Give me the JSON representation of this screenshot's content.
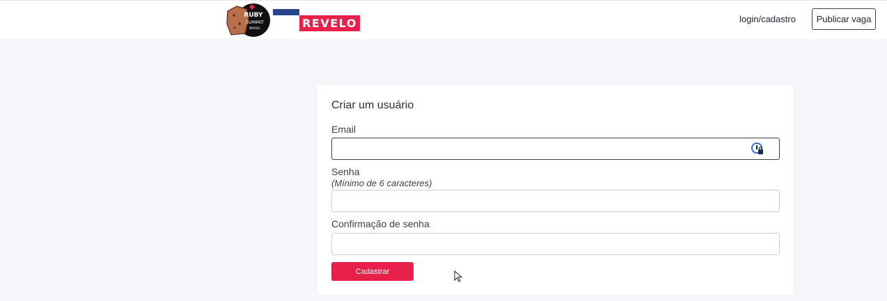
{
  "header": {
    "logo_ruby_lines": [
      "RUBY",
      "SUMMIT",
      "BRASIL"
    ],
    "logo_revelo": "REVELO",
    "login_link": "login/cadastro",
    "publish_button": "Publicar vaga"
  },
  "form": {
    "title": "Criar um usuário",
    "email_label": "Email",
    "email_value": "",
    "password_label": "Senha",
    "password_hint": "(Mínimo de 6 caracteres)",
    "password_value": "",
    "confirm_label": "Confirmação de senha",
    "confirm_value": "",
    "submit_label": "Cadastrar"
  },
  "colors": {
    "brand_red": "#e8214a",
    "brand_blue": "#27448f",
    "page_background": "#f4f6fa"
  },
  "icons": [
    "password-manager-icon",
    "mouse-cursor-icon"
  ]
}
